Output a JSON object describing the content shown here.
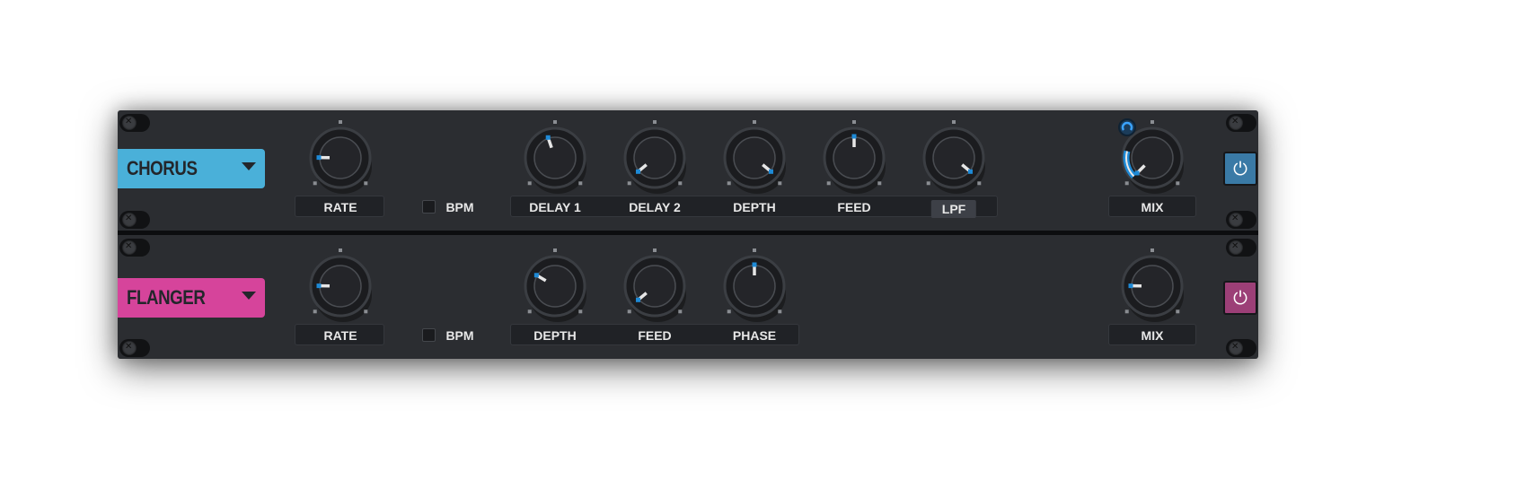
{
  "colors": {
    "chorus": "#4ab0d9",
    "flanger": "#d6449b",
    "accent": "#1e8ad6",
    "panel": "#2b2d31"
  },
  "modules": [
    {
      "name": "CHORUS",
      "color": "#4ab0d9",
      "power_icon": "power-icon",
      "power_on": true,
      "rate": {
        "label": "RATE",
        "value": 0.17
      },
      "bpm": {
        "label": "BPM",
        "checked": false
      },
      "knobs": [
        {
          "label": "DELAY 1",
          "value": 0.43
        },
        {
          "label": "DELAY 2",
          "value": 0.02
        },
        {
          "label": "DEPTH",
          "value": 0.98
        },
        {
          "label": "FEED",
          "value": 0.5
        },
        {
          "label": "LPF",
          "value": 0.98,
          "highlighted": true
        }
      ],
      "mix": {
        "label": "MIX",
        "value": 0.0,
        "modulation": 0.12,
        "modulation_icon": "modulation-ring-icon"
      }
    },
    {
      "name": "FLANGER",
      "color": "#d6449b",
      "power_icon": "power-icon",
      "power_on": true,
      "rate": {
        "label": "RATE",
        "value": 0.17
      },
      "bpm": {
        "label": "BPM",
        "checked": false
      },
      "knobs": [
        {
          "label": "DEPTH",
          "value": 0.28
        },
        {
          "label": "FEED",
          "value": 0.02
        },
        {
          "label": "PHASE",
          "value": 0.5
        }
      ],
      "mix": {
        "label": "MIX",
        "value": 0.17
      }
    }
  ]
}
